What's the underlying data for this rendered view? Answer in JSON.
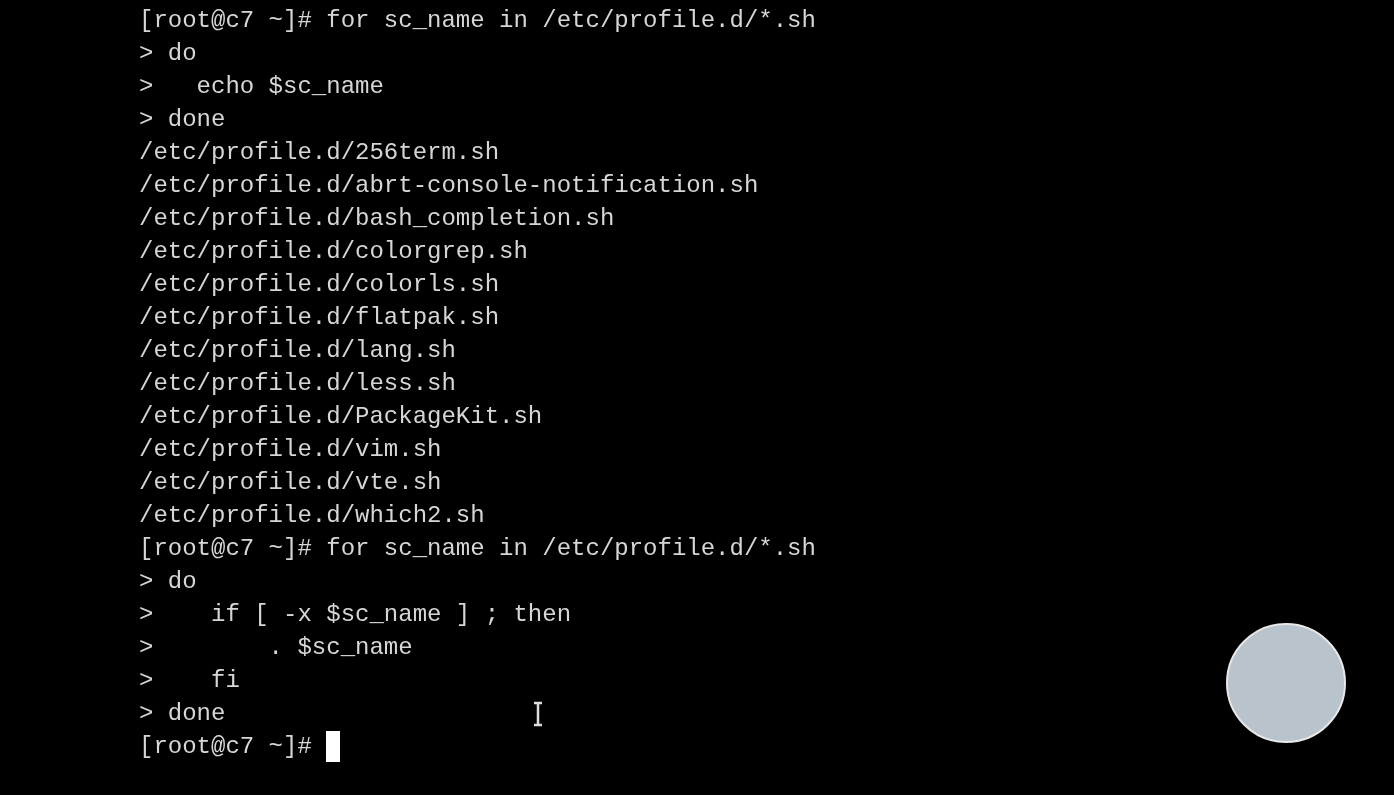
{
  "terminal": {
    "lines": [
      "[root@c7 ~]# for sc_name in /etc/profile.d/*.sh",
      "> do",
      ">   echo $sc_name",
      "> done",
      "/etc/profile.d/256term.sh",
      "/etc/profile.d/abrt-console-notification.sh",
      "/etc/profile.d/bash_completion.sh",
      "/etc/profile.d/colorgrep.sh",
      "/etc/profile.d/colorls.sh",
      "/etc/profile.d/flatpak.sh",
      "/etc/profile.d/lang.sh",
      "/etc/profile.d/less.sh",
      "/etc/profile.d/PackageKit.sh",
      "/etc/profile.d/vim.sh",
      "/etc/profile.d/vte.sh",
      "/etc/profile.d/which2.sh",
      "[root@c7 ~]# for sc_name in /etc/profile.d/*.sh",
      "> do",
      ">    if [ -x $sc_name ] ; then",
      ">        . $sc_name",
      ">    fi",
      "> done"
    ],
    "prompt": "[root@c7 ~]#"
  }
}
